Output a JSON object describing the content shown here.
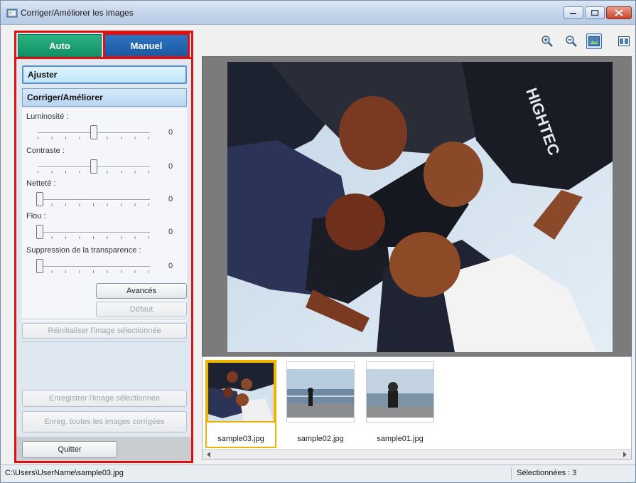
{
  "window": {
    "title": "Corriger/Améliorer les images",
    "controls": [
      "minimize",
      "maximize",
      "close"
    ]
  },
  "tabs": [
    {
      "label": "Auto",
      "active": false,
      "color": "#1a9a70"
    },
    {
      "label": "Manuel",
      "active": true,
      "color": "#1f63ad"
    }
  ],
  "sections": {
    "ajuster": "Ajuster",
    "corriger": "Corriger/Améliorer"
  },
  "sliders": [
    {
      "label": "Luminosité :",
      "value": "0",
      "level": 0.5
    },
    {
      "label": "Contraste :",
      "value": "0",
      "level": 0.5
    },
    {
      "label": "Netteté :",
      "value": "0",
      "level": 0.0
    },
    {
      "label": "Flou :",
      "value": "0",
      "level": 0.0
    },
    {
      "label": "Suppression de la transparence :",
      "value": "0",
      "level": 0.0
    }
  ],
  "buttons": {
    "avances": "Avancés",
    "defaut": "Défaut",
    "reinitialiser": "Réinitialiser l'image sélectionnée",
    "enregistrer": "Enregistrer l'image sélectionnée",
    "enreg_toutes": "Enreg. toutes les images corrigées",
    "quitter": "Quitter"
  },
  "toolbar": {
    "icons": [
      "zoom-in-icon",
      "zoom-out-icon",
      "full-image-view-icon",
      "compare-view-icon"
    ]
  },
  "thumbnails": [
    {
      "name": "sample03.jpg",
      "selected": true
    },
    {
      "name": "sample02.jpg",
      "selected": false
    },
    {
      "name": "sample01.jpg",
      "selected": false
    }
  ],
  "status": {
    "path": "C:\\Users\\UserName\\sample03.jpg",
    "selected": "Sélectionnées : 3"
  },
  "colors": {
    "highlight": "#e01010",
    "selection": "#f0b400"
  }
}
